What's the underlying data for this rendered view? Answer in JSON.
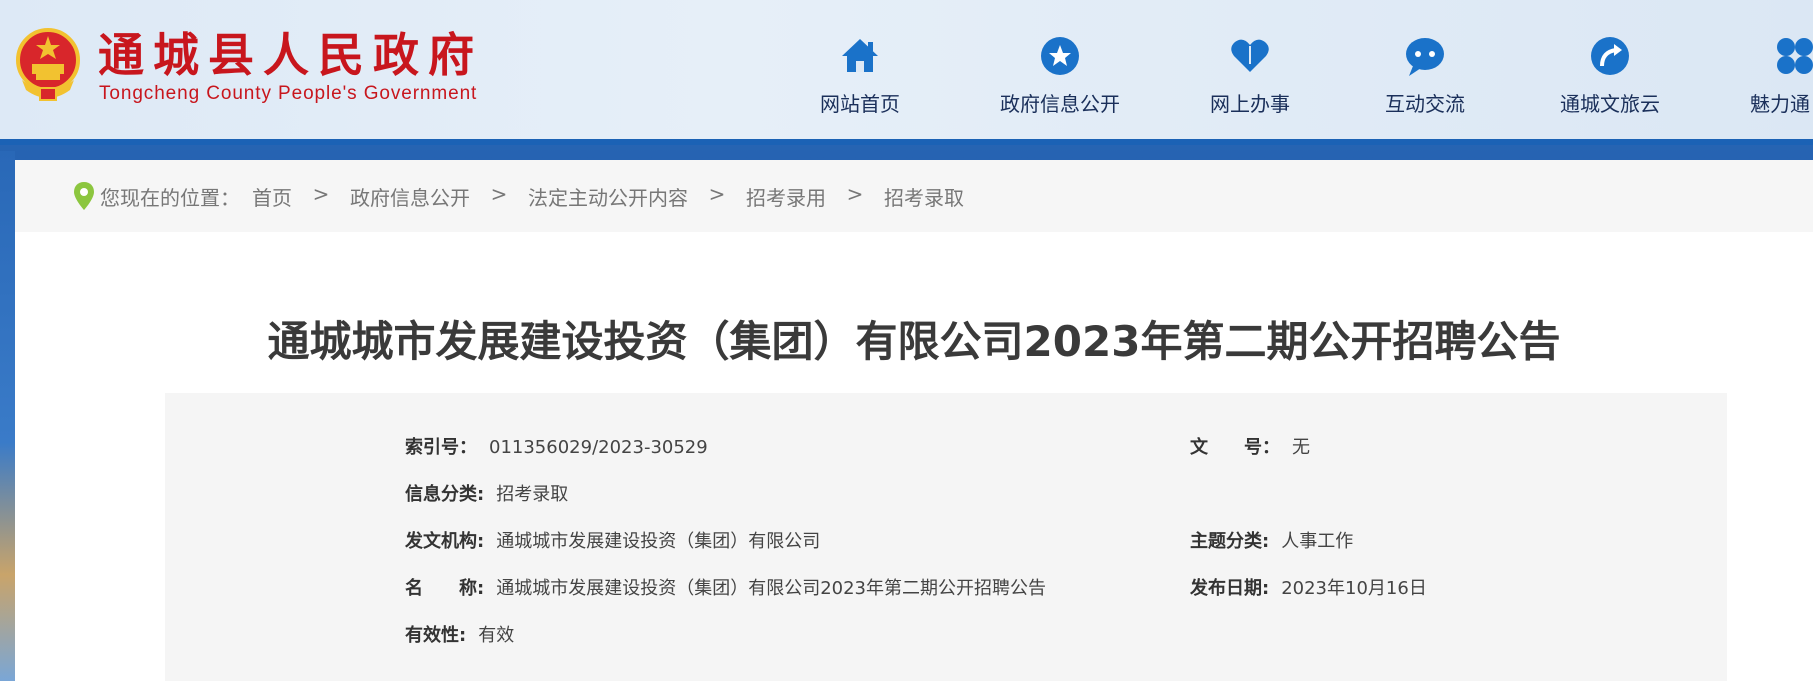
{
  "header": {
    "title": "通城县人民政府",
    "subtitle": "Tongcheng County People's Government"
  },
  "nav": [
    {
      "label": "网站首页",
      "icon": "home-icon"
    },
    {
      "label": "政府信息公开",
      "icon": "star-icon"
    },
    {
      "label": "网上办事",
      "icon": "heart-icon"
    },
    {
      "label": "互动交流",
      "icon": "chat-icon"
    },
    {
      "label": "通城文旅云",
      "icon": "arrow-icon"
    },
    {
      "label": "魅力通",
      "icon": "clover-icon"
    }
  ],
  "breadcrumb": {
    "prefix": "您现在的位置：",
    "items": [
      "首页",
      "政府信息公开",
      "法定主动公开内容",
      "招考录用",
      "招考录取"
    ],
    "separator": ">"
  },
  "article": {
    "title": "通城城市发展建设投资（集团）有限公司2023年第二期公开招聘公告"
  },
  "meta": {
    "index_key": "索引号：",
    "index_val": "011356029/2023-30529",
    "docno_key": "文　　号：",
    "docno_val": "无",
    "category_key": "信息分类:",
    "category_val": "招考录取",
    "issuer_key": "发文机构:",
    "issuer_val": "通城城市发展建设投资（集团）有限公司",
    "topic_key": "主题分类:",
    "topic_val": "人事工作",
    "name_key": "名　　称:",
    "name_val": "通城城市发展建设投资（集团）有限公司2023年第二期公开招聘公告",
    "date_key": "发布日期:",
    "date_val": "2023年10月16日",
    "valid_key": "有效性:",
    "valid_val": "有效"
  },
  "colors": {
    "brand_red": "#c8161d",
    "nav_icon_blue": "#1a72c9",
    "header_border": "#1b62b5"
  }
}
